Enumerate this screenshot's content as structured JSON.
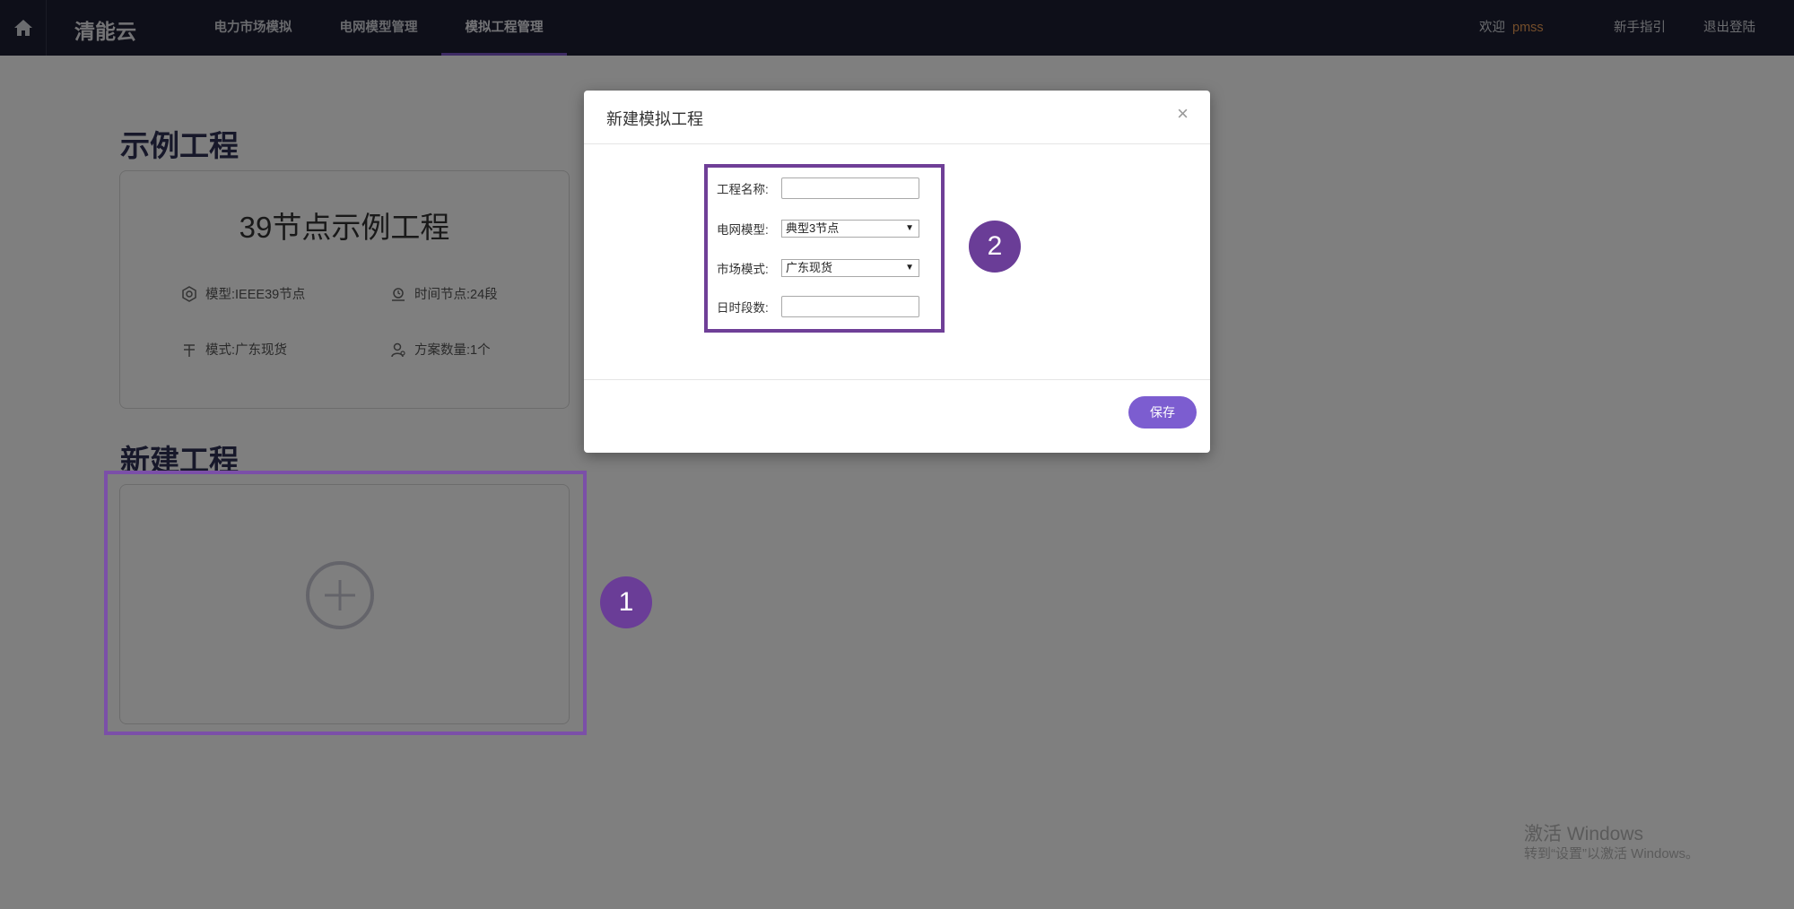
{
  "nav": {
    "brand": "清能云",
    "items": [
      {
        "label": "电力市场模拟",
        "active": false
      },
      {
        "label": "电网模型管理",
        "active": false
      },
      {
        "label": "模拟工程管理",
        "active": true
      }
    ],
    "welcome": "欢迎",
    "username": "pmss",
    "guide": "新手指引",
    "logout": "退出登陆"
  },
  "example_section": {
    "title": "示例工程",
    "card": {
      "title": "39节点示例工程",
      "model": "模型:IEEE39节点",
      "time_nodes": "时间节点:24段",
      "mode": "模式:广东现货",
      "plan_count": "方案数量:1个"
    }
  },
  "new_section": {
    "title": "新建工程"
  },
  "badges": {
    "step1": "1",
    "step2": "2"
  },
  "modal": {
    "title": "新建模拟工程",
    "close": "×",
    "fields": {
      "project_name_label": "工程名称:",
      "project_name_value": "",
      "grid_model_label": "电网模型:",
      "grid_model_value": "典型3节点",
      "market_mode_label": "市场模式:",
      "market_mode_value": "广东现货",
      "periods_label": "日时段数:",
      "periods_value": ""
    },
    "save_label": "保存"
  },
  "watermark": {
    "line1": "激活 Windows",
    "line2": "转到“设置”以激活 Windows。"
  },
  "colors": {
    "nav_bg": "#1d1f33",
    "accent": "#7c5dd0",
    "highlight": "#6f3f97",
    "username": "#e79a55"
  }
}
